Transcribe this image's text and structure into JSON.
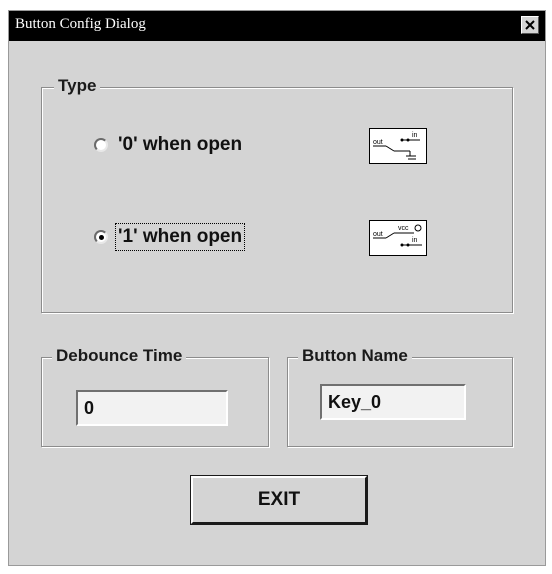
{
  "window": {
    "title": "Button Config Dialog",
    "close_glyph": "✕"
  },
  "type_group": {
    "label": "Type",
    "options": [
      {
        "label": "'0' when open",
        "selected": false,
        "diagram": {
          "out": "out",
          "in": "in"
        }
      },
      {
        "label": "'1' when open",
        "selected": true,
        "diagram": {
          "out": "out",
          "vcc": "vcc",
          "in": "in"
        }
      }
    ]
  },
  "debounce": {
    "label": "Debounce Time",
    "value": "0"
  },
  "button_name": {
    "label": "Button Name",
    "value": "Key_0"
  },
  "exit_button": {
    "label": "EXIT"
  },
  "colors": {
    "dialog_bg": "#d4d4d4",
    "titlebar": "#000000"
  }
}
